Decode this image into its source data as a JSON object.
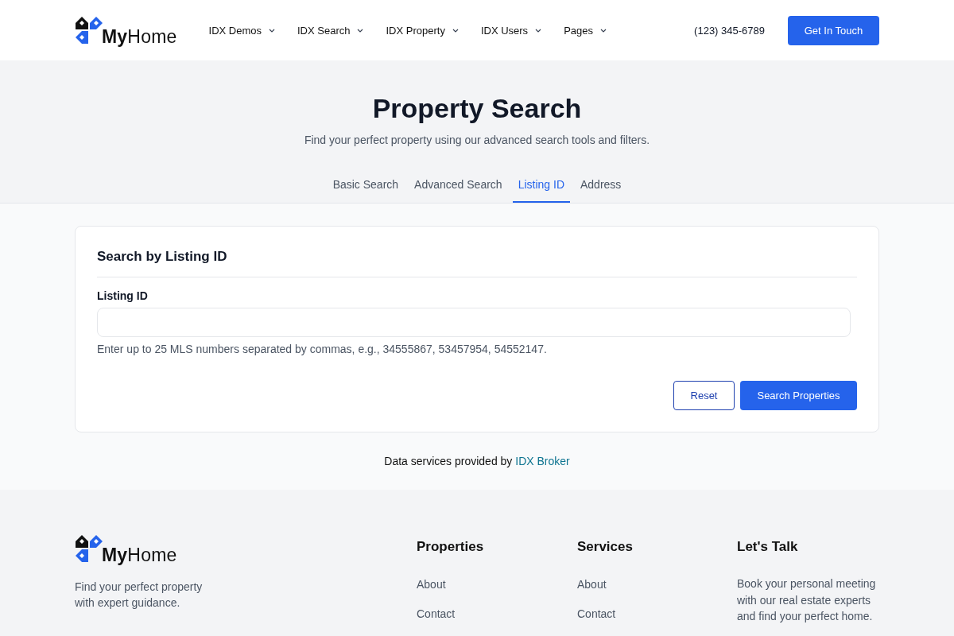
{
  "header": {
    "logo": "**My**Home",
    "nav": [
      {
        "label": "IDX Demos"
      },
      {
        "label": "IDX Search"
      },
      {
        "label": "IDX Property"
      },
      {
        "label": "IDX Users"
      },
      {
        "label": "Pages"
      }
    ],
    "phone": "(123) 345-6789",
    "cta": "Get In Touch"
  },
  "hero": {
    "title": "Property Search",
    "subtitle": "Find your perfect property using our advanced search tools and filters.",
    "tabs": [
      {
        "label": "Basic Search",
        "selected": false
      },
      {
        "label": "Advanced Search",
        "selected": false
      },
      {
        "label": "Listing ID",
        "selected": true
      },
      {
        "label": "Address",
        "selected": false
      }
    ]
  },
  "card": {
    "title": "Search by Listing ID",
    "field_label": "Listing ID",
    "help": "Enter up to 25 MLS numbers separated by commas, e.g., 34555867, 53457954, 54552147.",
    "buttons": [
      {
        "label": "Reset",
        "kind": "outline"
      },
      {
        "label": "Search Properties",
        "kind": "primary"
      }
    ]
  },
  "credit": {
    "text": "Data services provided by",
    "link": "IDX Broker"
  },
  "footer": {
    "logo": "**My**Home",
    "tagline": "Find your perfect property with expert guidance.",
    "columns": [
      {
        "title": "Properties",
        "links": [
          "About",
          "Contact"
        ]
      },
      {
        "title": "Services",
        "links": [
          "About",
          "Contact"
        ]
      },
      {
        "title": "Let's Talk",
        "text": "Book your personal meeting with our real estate experts and find your perfect home."
      }
    ]
  }
}
